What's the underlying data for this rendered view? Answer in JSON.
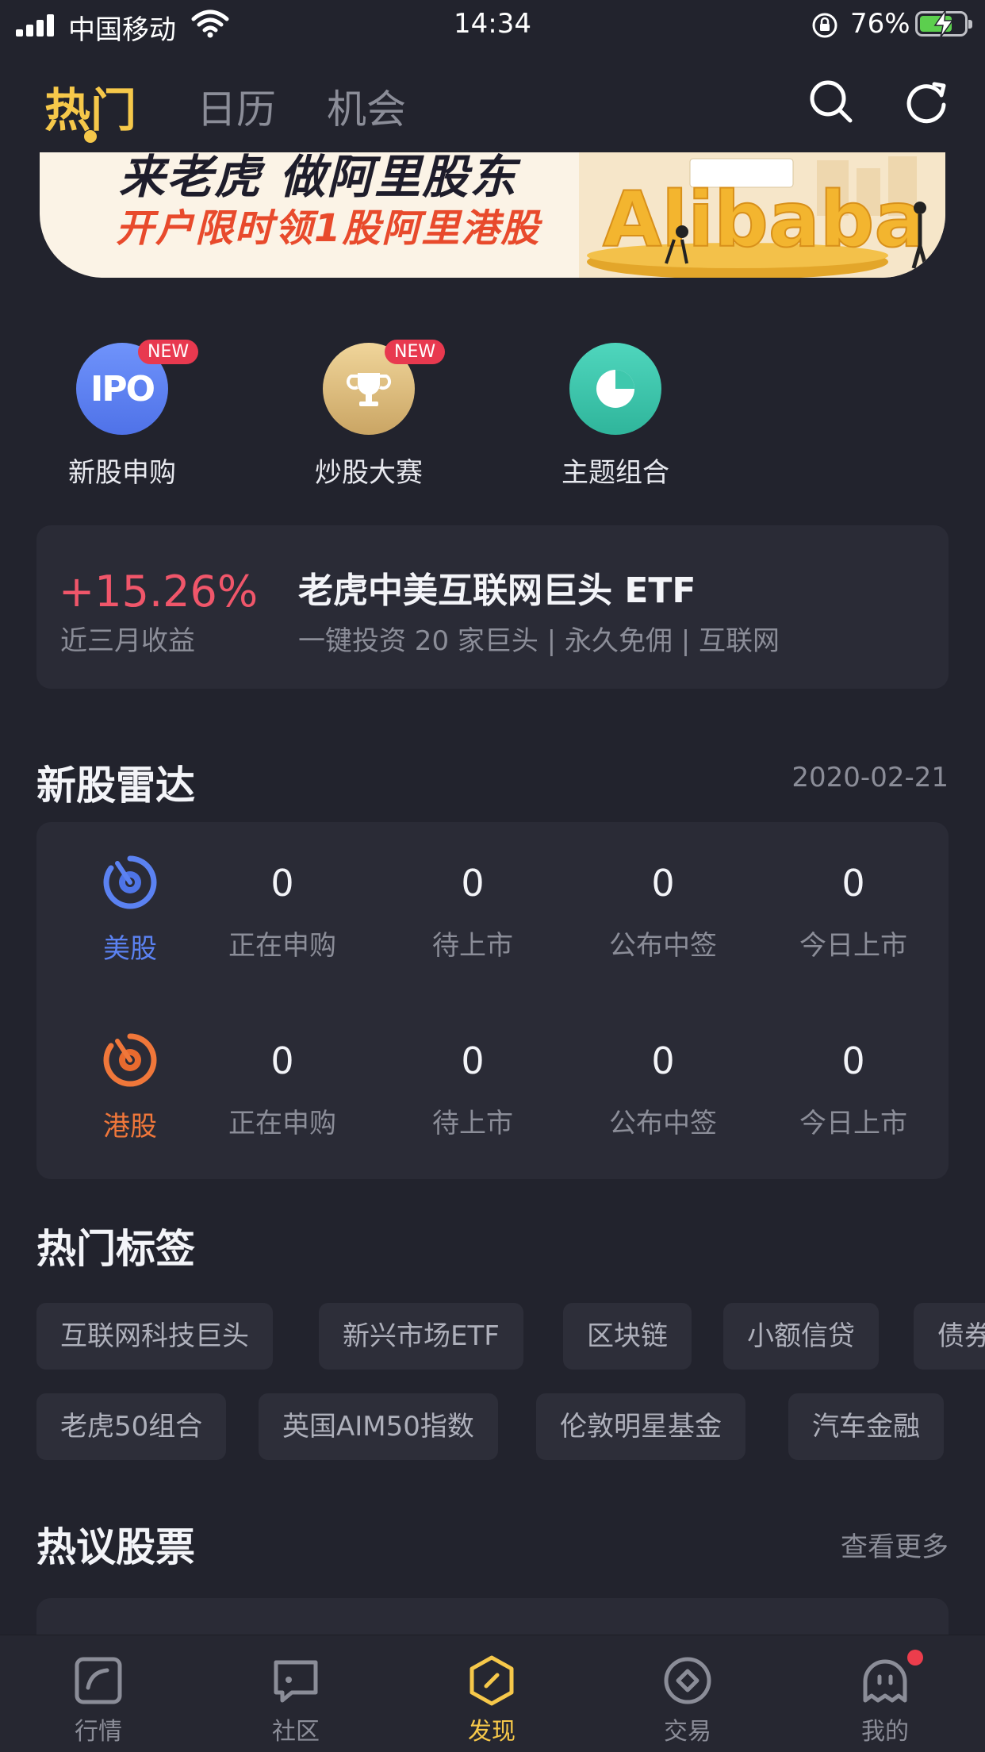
{
  "status_bar": {
    "carrier": "中国移动",
    "time": "14:34",
    "battery_percent": "76%"
  },
  "top_tabs": [
    "热门",
    "日历",
    "机会"
  ],
  "banner": {
    "line1": "来老虎 做阿里股东",
    "line2": "开户限时领1股阿里港股",
    "brand": "Alibaba"
  },
  "shortcuts": [
    {
      "label": "新股申购",
      "badge": "NEW",
      "icon_text": "IPO"
    },
    {
      "label": "炒股大赛",
      "badge": "NEW"
    },
    {
      "label": "主题组合"
    }
  ],
  "etf": {
    "return_pct": "+15.26%",
    "return_label": "近三月收益",
    "title": "老虎中美互联网巨头 ETF",
    "subtitle": "一键投资 20 家巨头 | 永久免佣 | 互联网"
  },
  "radar": {
    "title": "新股雷达",
    "date": "2020-02-21",
    "rows": [
      {
        "market": "美股",
        "color": "#5b82f2",
        "stats": [
          {
            "value": "0",
            "label": "正在申购"
          },
          {
            "value": "0",
            "label": "待上市"
          },
          {
            "value": "0",
            "label": "公布中签"
          },
          {
            "value": "0",
            "label": "今日上市"
          }
        ]
      },
      {
        "market": "港股",
        "color": "#f0773a",
        "stats": [
          {
            "value": "0",
            "label": "正在申购"
          },
          {
            "value": "0",
            "label": "待上市"
          },
          {
            "value": "0",
            "label": "公布中签"
          },
          {
            "value": "0",
            "label": "今日上市"
          }
        ]
      }
    ]
  },
  "hot_tags": {
    "title": "热门标签",
    "row1": [
      "互联网科技巨头",
      "新兴市场ETF",
      "区块链",
      "小额信贷",
      "债券"
    ],
    "row2": [
      "老虎50组合",
      "英国AIM50指数",
      "伦敦明星基金",
      "汽车金融"
    ]
  },
  "hot_stocks": {
    "title": "热议股票",
    "more": "查看更多"
  },
  "tabbar": [
    {
      "label": "行情",
      "icon": "chart-icon"
    },
    {
      "label": "社区",
      "icon": "community-icon"
    },
    {
      "label": "发现",
      "icon": "discover-icon",
      "active": true
    },
    {
      "label": "交易",
      "icon": "trade-icon"
    },
    {
      "label": "我的",
      "icon": "profile-icon"
    }
  ],
  "colors": {
    "accent": "#f6c84a",
    "up": "#f0566a",
    "us_market": "#5b82f2",
    "hk_market": "#f0773a"
  }
}
